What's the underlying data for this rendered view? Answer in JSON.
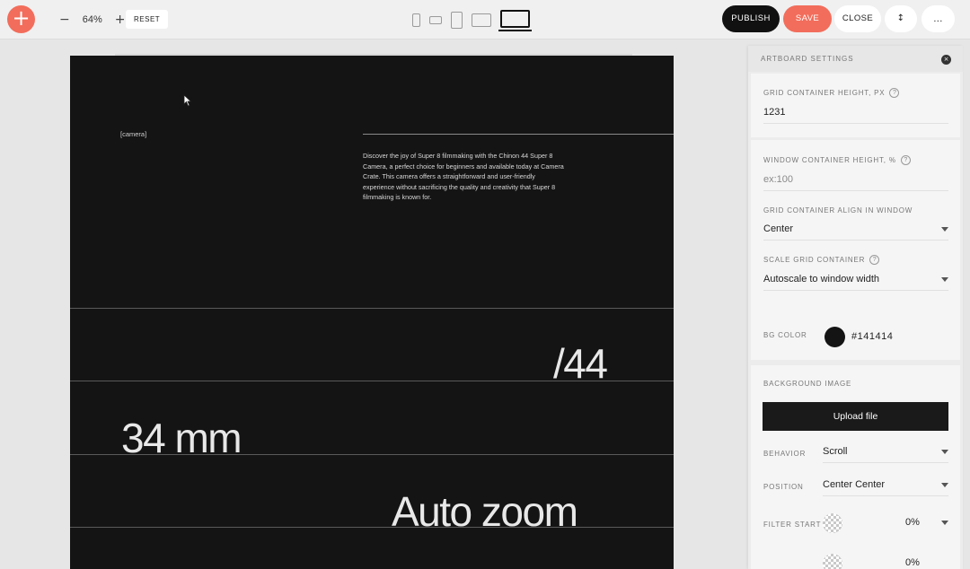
{
  "toolbar": {
    "add_icon": "+",
    "zoom_out": "−",
    "zoom_level": "64%",
    "zoom_in": "+",
    "reset_label": "RESET",
    "devices": [
      "phone-portrait-icon",
      "phone-landscape-icon",
      "tablet-portrait-icon",
      "tablet-landscape-icon",
      "desktop-icon"
    ],
    "publish_label": "PUBLISH",
    "save_label": "SAVE",
    "close_label": "CLOSE",
    "share_label": "↕",
    "more_label": "...",
    "colors": {
      "accent": "#f26d5b",
      "dark": "#111111"
    }
  },
  "artboard": {
    "background": "#141414",
    "camera_label": "[camera]",
    "description": "Discover the joy of Super 8 filmmaking with the Chinon 44 Super 8 Camera, a perfect choice for beginners and available today at Camera Crate. This camera offers a straightforward and user-friendly experience without sacrificing the quality and creativity that Super 8 filmmaking is known for.",
    "headline_44": "/44",
    "headline_mm": "34 mm",
    "headline_zoom": "Auto zoom"
  },
  "panel": {
    "title": "ARTBOARD SETTINGS",
    "close_icon": "×",
    "grid_height": {
      "label": "GRID CONTAINER HEIGHT, PX",
      "help": "?",
      "value": "1231"
    },
    "window_height": {
      "label": "WINDOW CONTAINER HEIGHT, %",
      "help": "?",
      "placeholder": "ex:100"
    },
    "grid_align": {
      "label": "GRID CONTAINER ALIGN IN WINDOW",
      "value": "Center"
    },
    "scale_grid": {
      "label": "SCALE GRID CONTAINER",
      "help": "?",
      "value": "Autoscale to window width"
    },
    "bg_color": {
      "label": "BG COLOR",
      "value": "#141414",
      "swatch": "#141414"
    },
    "bg_image": {
      "label": "BACKGROUND IMAGE",
      "upload_label": "Upload file",
      "behavior_label": "BEHAVIOR",
      "behavior_value": "Scroll",
      "position_label": "POSITION",
      "position_value": "Center Center",
      "filter_start_label": "FILTER START",
      "filter_start_value": "0%",
      "filter_end_value": "0%"
    }
  }
}
